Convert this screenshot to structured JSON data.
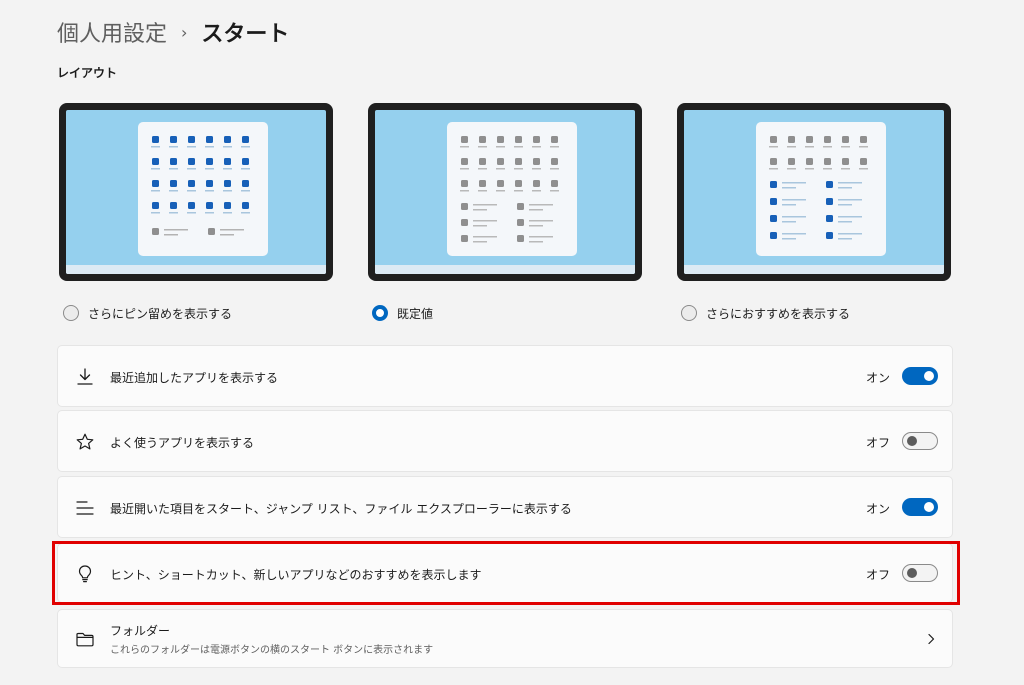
{
  "breadcrumb": {
    "parent": "個人用設定",
    "separator": "›",
    "current": "スタート"
  },
  "layout_section": {
    "label": "レイアウト"
  },
  "layout_options": [
    {
      "label": "さらにピン留めを表示する",
      "selected": false
    },
    {
      "label": "既定値",
      "selected": true
    },
    {
      "label": "さらにおすすめを表示する",
      "selected": false
    }
  ],
  "settings": [
    {
      "label": "最近追加したアプリを表示する",
      "icon": "download-icon",
      "state": "オン",
      "on": true
    },
    {
      "label": "よく使うアプリを表示する",
      "icon": "star-icon",
      "state": "オフ",
      "on": false
    },
    {
      "label": "最近開いた項目をスタート、ジャンプ リスト、ファイル エクスプローラーに表示する",
      "icon": "list-icon",
      "state": "オン",
      "on": true
    },
    {
      "label": "ヒント、ショートカット、新しいアプリなどのおすすめを表示します",
      "icon": "lightbulb-icon",
      "state": "オフ",
      "on": false
    }
  ],
  "folders": {
    "title": "フォルダー",
    "subtitle": "これらのフォルダーは電源ボタンの横のスタート ボタンに表示されます",
    "icon": "folder-icon"
  },
  "colors": {
    "accent": "#0067c0",
    "highlight": "#e00000",
    "preview_bg": "#95d0ee",
    "pin_blue": "#1760b8",
    "pin_gray": "#8f8f8f"
  }
}
